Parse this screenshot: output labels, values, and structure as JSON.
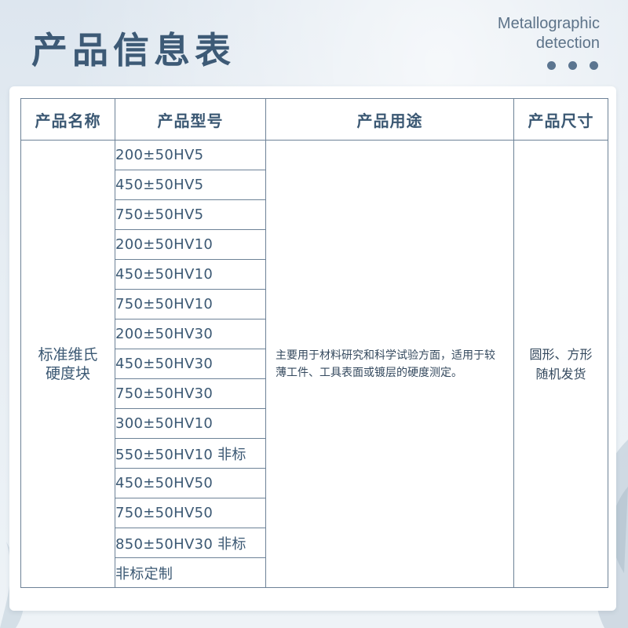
{
  "header": {
    "title": "产品信息表",
    "brand_line1": "Metallographic",
    "brand_line2": "detection"
  },
  "table": {
    "columns": [
      "产品名称",
      "产品型号",
      "产品用途",
      "产品尺寸"
    ],
    "name_line1": "标准维氏",
    "name_line2": "硬度块",
    "models": [
      "200±50HV5",
      "450±50HV5",
      "750±50HV5",
      "200±50HV10",
      "450±50HV10",
      "750±50HV10",
      "200±50HV30",
      "450±50HV30",
      "750±50HV30",
      "300±50HV10",
      "550±50HV10 非标",
      "450±50HV50",
      "750±50HV50",
      "850±50HV30 非标",
      "非标定制"
    ],
    "usage": "主要用于材料研究和科学试验方面，适用于较薄工件、工具表面或镀层的硬度测定。",
    "size_line1": "圆形、方形",
    "size_line2": "随机发货"
  }
}
